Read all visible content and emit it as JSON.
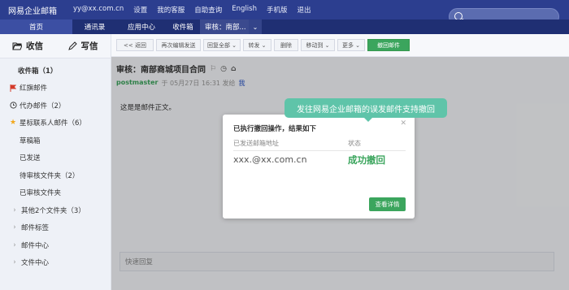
{
  "topbar": {
    "brand": "网易企业邮箱",
    "links": [
      "yy@xx.com.cn",
      "设置",
      "我的客服",
      "自助查询",
      "English",
      "手机版",
      "退出"
    ]
  },
  "navbar": {
    "tabs": [
      "首页",
      "通讯录",
      "应用中心",
      "收件箱",
      "审核：南部...",
      "⌄"
    ]
  },
  "sidebar": {
    "inbox": "收信",
    "compose": "写信",
    "items": [
      "收件箱（1）",
      "红旗邮件",
      "代办邮件（2）",
      "星标联系人邮件（6）",
      "草稿箱",
      "已发送",
      "待审核文件夹（2）",
      "已审核文件夹",
      "其他2个文件夹（3）",
      "邮件标签",
      "邮件中心",
      "文件中心"
    ]
  },
  "toolbar": {
    "buttons": [
      "<< 返回",
      "再次编辑发送",
      "回复全部 ⌄",
      "转发 ⌄",
      "删除",
      "移动到 ⌄",
      "更多 ⌄",
      "撤回邮件"
    ]
  },
  "mail": {
    "subject": "审核：南部商城项目合同",
    "sender": "postmaster",
    "date_text": "于 05月27日 16:31 发给",
    "recipient": "我",
    "body": "这是是邮件正文。",
    "quick_reply": "快速回复"
  },
  "dialog": {
    "title": "已执行撤回操作，结果如下",
    "col_addr": "已发送邮箱地址",
    "col_status": "状态",
    "address": "xxx.@xx.com.cn",
    "status": "成功撤回",
    "button": "查看详情"
  },
  "tooltip": {
    "text": "发往网易企业邮箱的误发邮件支持撤回"
  },
  "colors": {
    "topbar": "#2c3e8f",
    "accent_green": "#3ba55d",
    "tooltip": "#5fc4a9"
  }
}
